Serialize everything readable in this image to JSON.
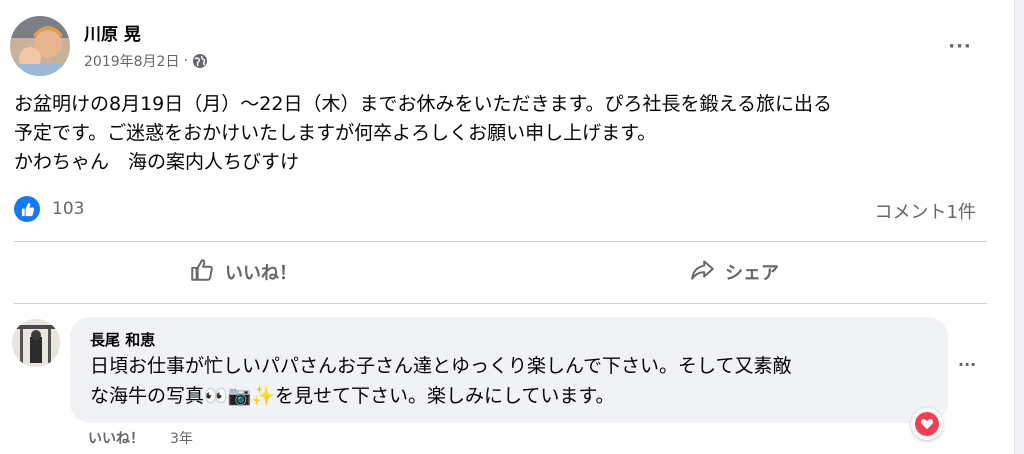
{
  "post": {
    "author": "川原 晃",
    "date": "2019年8月2日",
    "separator": "·",
    "privacy_icon": "globe-icon",
    "more_icon": "···",
    "lines": [
      "お盆明けの8月19日（月）〜22日（木）までお休みをいただきます。ぴろ社長を鍛える旅に出る",
      "予定です。ご迷惑をおかけいたしますが何卒よろしくお願い申し上げます。",
      "かわちゃん　海の案内人ちびすけ"
    ],
    "reaction_count": "103",
    "comment_count": "コメント1件"
  },
  "actions": {
    "like_label": "いいね！",
    "share_label": "シェア"
  },
  "comment": {
    "author": "長尾 和恵",
    "lines": [
      "日頃お仕事が忙しいパパさんお子さん達とゆっくり楽しんで下さい。そして又素敵",
      "な海牛の写真👀📷✨を見せて下さい。楽しみにしています。"
    ],
    "like_label": "いいね！",
    "time": "3年",
    "more_icon": "···"
  },
  "colors": {
    "accent": "#1877f2",
    "muted": "#65676b",
    "heart": "#f33e58"
  }
}
